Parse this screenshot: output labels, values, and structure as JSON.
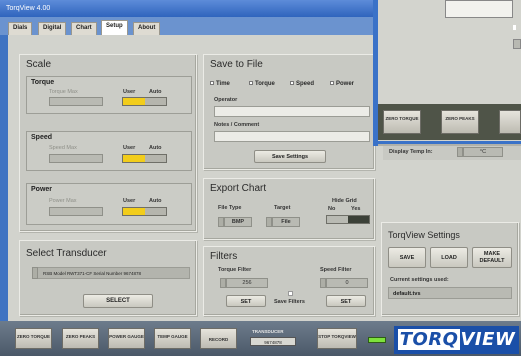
{
  "window_title": "TorqView 4.00",
  "tabs": [
    "Dials",
    "Digital",
    "Chart",
    "Setup",
    "About"
  ],
  "active_tab": "Setup",
  "scale": {
    "title": "Scale",
    "user_label": "User",
    "auto_label": "Auto",
    "torque": {
      "title": "Torque",
      "max_label": "Torque Max"
    },
    "speed": {
      "title": "Speed",
      "max_label": "Speed Max"
    },
    "power": {
      "title": "Power",
      "max_label": "Power Max"
    }
  },
  "save_to_file": {
    "title": "Save to File",
    "checkboxes": [
      "Time",
      "Torque",
      "Speed",
      "Power"
    ],
    "operator_label": "Operator",
    "notes_label": "Notes / Comment",
    "save_settings_label": "Save Settings"
  },
  "export_chart": {
    "title": "Export Chart",
    "file_type_label": "File Type",
    "file_type_value": "BMP",
    "target_label": "Target",
    "target_value": "File",
    "hide_grid_label": "Hide Grid",
    "no_label": "No",
    "yes_label": "Yes"
  },
  "filters": {
    "title": "Filters",
    "torque_filter_label": "Torque Filter",
    "torque_filter_value": "256",
    "speed_filter_label": "Speed Filter",
    "speed_filter_value": "0",
    "set_label": "SET",
    "save_filters_label": "Save Filters"
  },
  "select_transducer": {
    "title": "Select Transducer",
    "selected_value": "RSB Model RWT371-CF Serial Number 9674878",
    "select_label": "SELECT"
  },
  "overlay": {
    "display_temp_label": "Display Temp In:",
    "display_temp_value": "°C",
    "buttons": [
      "ZERO TORQUE",
      "ZERO PEAKS"
    ]
  },
  "torqview_settings": {
    "title": "TorqView Settings",
    "save_label": "SAVE",
    "load_label": "LOAD",
    "make_default_label": "MAKE DEFAULT",
    "current_settings_label": "Current settings used:",
    "current_settings_value": "default.tvs"
  },
  "bottom_bar": {
    "buttons": [
      "ZERO TORQUE",
      "ZERO PEAKS",
      "POWER GAUGE",
      "TEMP GAUGE",
      "RECORD"
    ],
    "transducer_label": "TRANSDUCER",
    "transducer_serial": "9674878",
    "stop_label": "STOP TORQVIEW",
    "logo_left": "TORQ",
    "logo_right": "VIEW"
  },
  "colors": {
    "accent_toggle": "#f2cd1b",
    "frame_blue": "#3f73c2",
    "panel_grey": "#d2d3cd"
  }
}
